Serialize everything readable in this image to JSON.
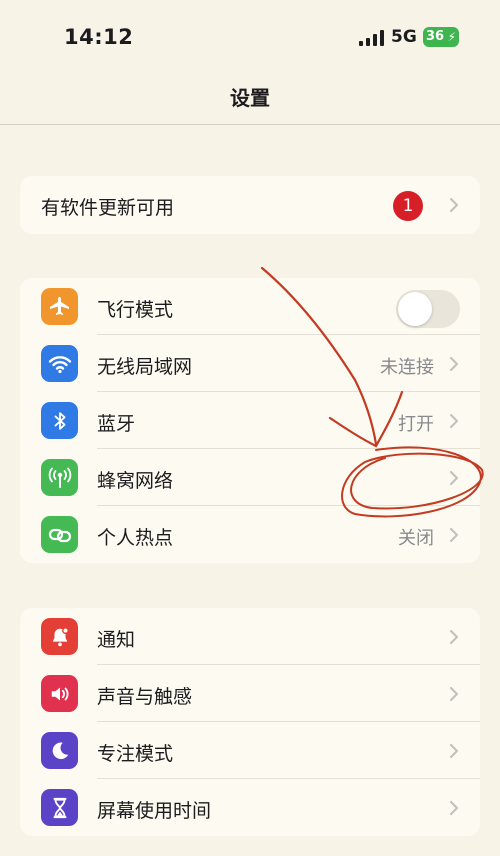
{
  "status_bar": {
    "time": "14:12",
    "network": "5G",
    "battery": "36"
  },
  "nav": {
    "title": "设置"
  },
  "update": {
    "label": "有软件更新可用",
    "badge": "1"
  },
  "connectivity": [
    {
      "label": "飞行模式",
      "value": "",
      "icon": "airplane-icon",
      "color": "#f0962c"
    },
    {
      "label": "无线局域网",
      "value": "未连接",
      "icon": "wifi-icon",
      "color": "#2f7ae5"
    },
    {
      "label": "蓝牙",
      "value": "打开",
      "icon": "bluetooth-icon",
      "color": "#2f7ae5"
    },
    {
      "label": "蜂窝网络",
      "value": "",
      "icon": "antenna-icon",
      "color": "#44b954"
    },
    {
      "label": "个人热点",
      "value": "关闭",
      "icon": "hotspot-icon",
      "color": "#44b954"
    }
  ],
  "system": [
    {
      "label": "通知",
      "icon": "bell-icon",
      "color": "#e43f36"
    },
    {
      "label": "声音与触感",
      "icon": "speaker-icon",
      "color": "#e0324f"
    },
    {
      "label": "专注模式",
      "icon": "moon-icon",
      "color": "#5b43c7"
    },
    {
      "label": "屏幕使用时间",
      "icon": "hourglass-icon",
      "color": "#5b43c7"
    }
  ],
  "airplane_mode_on": false
}
